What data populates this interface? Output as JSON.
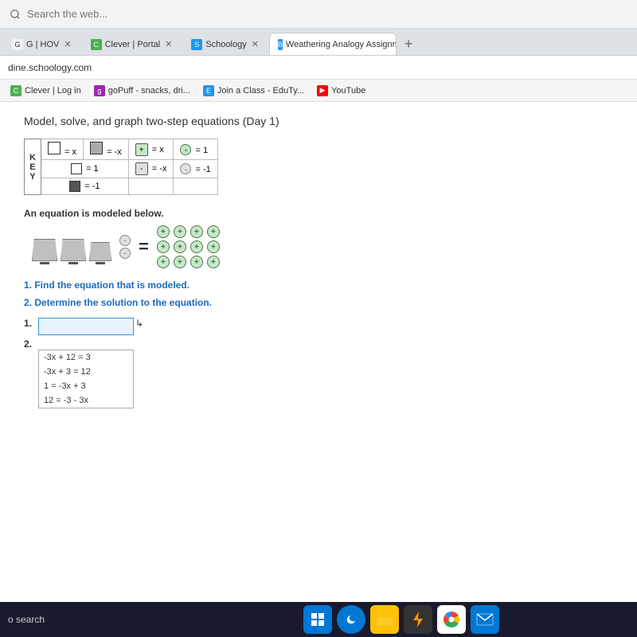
{
  "browser": {
    "search_placeholder": "Search the web...",
    "address": "dine.schoology.com",
    "tabs": [
      {
        "id": "tab1",
        "label": "G | HOV",
        "active": false,
        "favicon": "G"
      },
      {
        "id": "tab2",
        "label": "Clever | Portal",
        "active": false,
        "favicon": "C",
        "color": "#4CAF50"
      },
      {
        "id": "tab3",
        "label": "Schoology",
        "active": false,
        "favicon": "S",
        "color": "#2196F3"
      },
      {
        "id": "tab4",
        "label": "Weathering Analogy Assignment",
        "active": true,
        "favicon": "B",
        "color": "#2196F3"
      }
    ],
    "bookmarks": [
      {
        "id": "bm1",
        "label": "Clever | Log in",
        "favicon": "C",
        "color": "#4CAF50"
      },
      {
        "id": "bm2",
        "label": "goPuff - snacks, dri...",
        "favicon": "g",
        "color": "#9c27b0"
      },
      {
        "id": "bm3",
        "label": "Join a Class - EduTy...",
        "favicon": "E",
        "color": "#2196F3"
      },
      {
        "id": "bm4",
        "label": "YouTube",
        "favicon": "▶",
        "color": "#FF0000"
      }
    ]
  },
  "page": {
    "title": "Model, solve, and graph two-step equations (Day 1)",
    "model_label": "An equation is modeled below.",
    "question1": "1. Find the equation that is modeled.",
    "question2": "2. Determine the solution to the equation.",
    "key_label": "K\nE\nY",
    "answer_1_label": "1.",
    "answer_2_label": "2.",
    "dropdown_options": [
      {
        "label": "-3x + 12 = 3",
        "selected": false
      },
      {
        "label": "-3x + 3 = 12",
        "selected": false
      },
      {
        "label": "1 = -3x + 3",
        "selected": false
      },
      {
        "label": "12 = -3 - 3x",
        "selected": false
      }
    ]
  },
  "taskbar": {
    "search_text": "o search",
    "icons": [
      "windows",
      "edge",
      "folder",
      "bolt",
      "chrome",
      "mail"
    ]
  }
}
